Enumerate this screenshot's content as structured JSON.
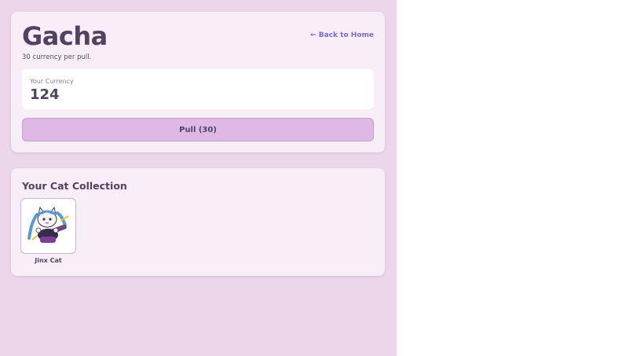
{
  "gacha": {
    "title": "Gacha",
    "back_link": "← Back to Home",
    "subtitle": "30 currency per pull.",
    "currency_label": "Your Currency",
    "currency_value": "124",
    "pull_button": "Pull (30)"
  },
  "collection": {
    "title": "Your Cat Collection",
    "items": [
      {
        "name": "Jinx Cat",
        "image": "jinx-cat-illustration"
      }
    ]
  },
  "colors": {
    "page_background": "#ecd7ea",
    "card_background": "#f8eef7",
    "accent_link": "#7a6ad0",
    "pull_button": "#dfb8e5",
    "text": "#4e4462"
  }
}
